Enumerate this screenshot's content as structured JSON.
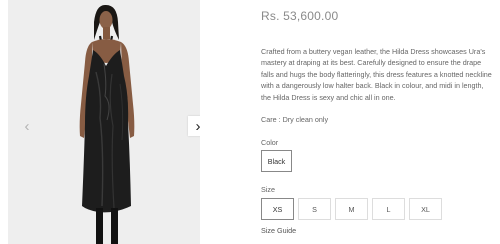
{
  "product": {
    "price": "Rs. 53,600.00",
    "description": "Crafted from a buttery vegan leather, the Hilda Dress showcases Ura's mastery at draping at its best. Carefully designed to ensure the drape falls and hugs the body flatteringly, this dress features a knotted neckline with a dangerously low halter back. Black in colour, and midi in length, the Hilda Dress is sexy and chic all in one.",
    "care": "Care : Dry clean only"
  },
  "gallery": {
    "prev_icon": "chevron-left-icon",
    "next_icon": "chevron-right-icon",
    "prev_glyph": "‹",
    "next_glyph": "›"
  },
  "color": {
    "label": "Color",
    "options": [
      "Black"
    ],
    "selected": "Black"
  },
  "size": {
    "label": "Size",
    "options": [
      "XS",
      "S",
      "M",
      "L",
      "XL"
    ],
    "selected": "XS",
    "guide_label": "Size Guide"
  }
}
